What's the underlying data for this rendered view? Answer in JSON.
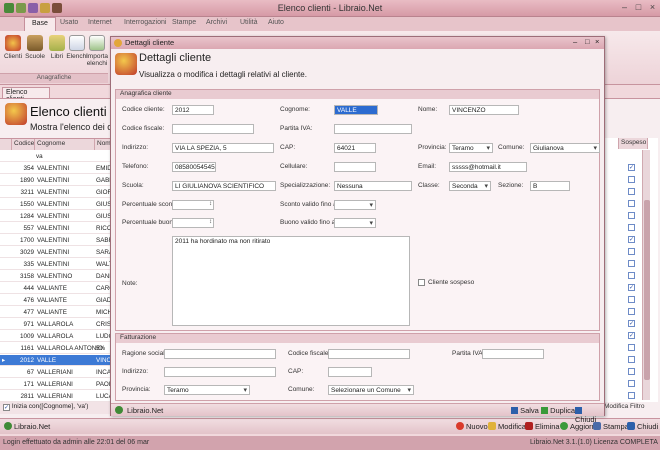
{
  "window": {
    "title": "Elenco clienti - Libraio.Net",
    "controls": [
      "–",
      "□",
      "×"
    ]
  },
  "ribbon": {
    "tabs": [
      "Base",
      "Usato",
      "Internet",
      "Interrogazioni",
      "Stampe",
      "Archivi",
      "Utilità",
      "Aiuto"
    ],
    "active_tab": "Base",
    "buttons": [
      "Clienti",
      "Scuole",
      "Libri",
      "Elenchi",
      "Importa elenchi"
    ],
    "group_label": "Anagrafiche"
  },
  "document_tab": "Elenco clienti",
  "list_form": {
    "title": "Elenco clienti",
    "subtitle": "Mostra l'elenco dei clienti",
    "columns": [
      "Codice",
      "Cognome",
      "Nome"
    ],
    "right_column": "Sospeso",
    "filter_value": "va",
    "rows": [
      {
        "code": "354",
        "surname": "VALENTINI",
        "name": "EMIDI",
        "suspended": true
      },
      {
        "code": "1890",
        "surname": "VALENTINI",
        "name": "GABRI",
        "suspended": false
      },
      {
        "code": "3211",
        "surname": "VALENTINI",
        "name": "GIORG",
        "suspended": false
      },
      {
        "code": "1550",
        "surname": "VALENTINI",
        "name": "GIUSE",
        "suspended": false
      },
      {
        "code": "1284",
        "surname": "VALENTINI",
        "name": "GIUSE",
        "suspended": false
      },
      {
        "code": "557",
        "surname": "VALENTINI",
        "name": "RICCA",
        "suspended": false
      },
      {
        "code": "1700",
        "surname": "VALENTINI",
        "name": "SABRI",
        "suspended": true
      },
      {
        "code": "3029",
        "surname": "VALENTINI",
        "name": "SARA",
        "suspended": false
      },
      {
        "code": "335",
        "surname": "VALENTINI",
        "name": "WALTE",
        "suspended": false
      },
      {
        "code": "3158",
        "surname": "VALENTINO",
        "name": "DANIE",
        "suspended": false
      },
      {
        "code": "444",
        "surname": "VALIANTE",
        "name": "CAROL",
        "suspended": true
      },
      {
        "code": "476",
        "surname": "VALIANTE",
        "name": "GIADA",
        "suspended": false
      },
      {
        "code": "477",
        "surname": "VALIANTE",
        "name": "MICHE",
        "suspended": false
      },
      {
        "code": "971",
        "surname": "VALLAROLA",
        "name": "CRIST",
        "suspended": true
      },
      {
        "code": "1009",
        "surname": "VALLAROLA",
        "name": "LUDOV",
        "suspended": true
      },
      {
        "code": "1161",
        "surname": "VALLAROLA ANTONIO",
        "name": "5%",
        "suspended": false
      },
      {
        "code": "2012",
        "surname": "VALLE",
        "name": "VINCE",
        "suspended": false,
        "selected": true
      },
      {
        "code": "67",
        "surname": "VALLERIANI",
        "name": "INCA",
        "suspended": false
      },
      {
        "code": "171",
        "surname": "VALLERIANI",
        "name": "PAOL",
        "suspended": false
      },
      {
        "code": "2811",
        "surname": "VALLERIANI",
        "name": "LUCA",
        "suspended": false
      }
    ],
    "filter_text": "Inizia con([Cognome], 'va')",
    "modifica_filtro": "Modifica Filtro"
  },
  "dialog": {
    "window_title": "Dettagli cliente",
    "title": "Dettagli cliente",
    "subtitle": "Visualizza o modifica i dettagli relativi al cliente.",
    "anagrafica_header": "Anagrafica cliente",
    "labels": {
      "codice": "Codice cliente:",
      "cognome": "Cognome:",
      "nome": "Nome:",
      "codice_fiscale": "Codice fiscale:",
      "partita_iva": "Partita IVA:",
      "indirizzo": "Indirizzo:",
      "cap": "CAP:",
      "provincia": "Provincia:",
      "comune": "Comune:",
      "telefono": "Telefono:",
      "cellulare": "Cellulare:",
      "email": "Email:",
      "scuola": "Scuola:",
      "specializzazione": "Specializzazione:",
      "classe": "Classe:",
      "sezione": "Sezione:",
      "perc_sconto": "Percentuale sconto:",
      "sconto_fino": "Sconto valido fino al:",
      "perc_buono": "Percentuale buono:",
      "buono_fino": "Buono valido fino al:",
      "note": "Note:",
      "sospeso": "Cliente sospeso"
    },
    "values": {
      "codice": "2012",
      "cognome": "VALLE",
      "nome": "VINCENZO",
      "codice_fiscale": "",
      "partita_iva": "",
      "indirizzo": "VIA LA SPEZIA, 5",
      "cap": "64021",
      "provincia": "Teramo",
      "comune": "Giulianova",
      "telefono": "08580054545",
      "cellulare": "",
      "email": "sssss@hotmail.it",
      "scuola": "LI GIULIANOVA SCIENTIFICO",
      "specializzazione": "Nessuna",
      "classe": "Seconda",
      "sezione": "B",
      "note": "2011 ha hordinato ma non ritirato"
    },
    "fatturazione_header": "Fatturazione",
    "fatt_labels": {
      "ragione": "Ragione sociale:",
      "cf": "Codice fiscale:",
      "piva": "Partita IVA:",
      "indirizzo": "Indirizzo:",
      "cap": "CAP:",
      "provincia": "Provincia:",
      "comune": "Comune:"
    },
    "fatt_values": {
      "provincia": "Teramo",
      "comune": "Selezionare un Comune"
    },
    "footer_brand": "Libraio.Net",
    "footer_buttons": [
      "Salva",
      "Duplica",
      "Chiudi"
    ]
  },
  "action_bar": {
    "brand": "Libraio.Net",
    "buttons": [
      "Nuovo",
      "Modifica",
      "Elimina",
      "Aggiorna",
      "Stampa",
      "Chiudi"
    ]
  },
  "status": {
    "left": "Login effettuato da admin alle 22:01 del 06 mar",
    "right": "Libraio.Net 3.1.(1.0) Licenza COMPLETA"
  },
  "colors": {
    "accent": "#2c6bd0",
    "frame": "#d69aa6",
    "panel": "#f7eef0"
  }
}
